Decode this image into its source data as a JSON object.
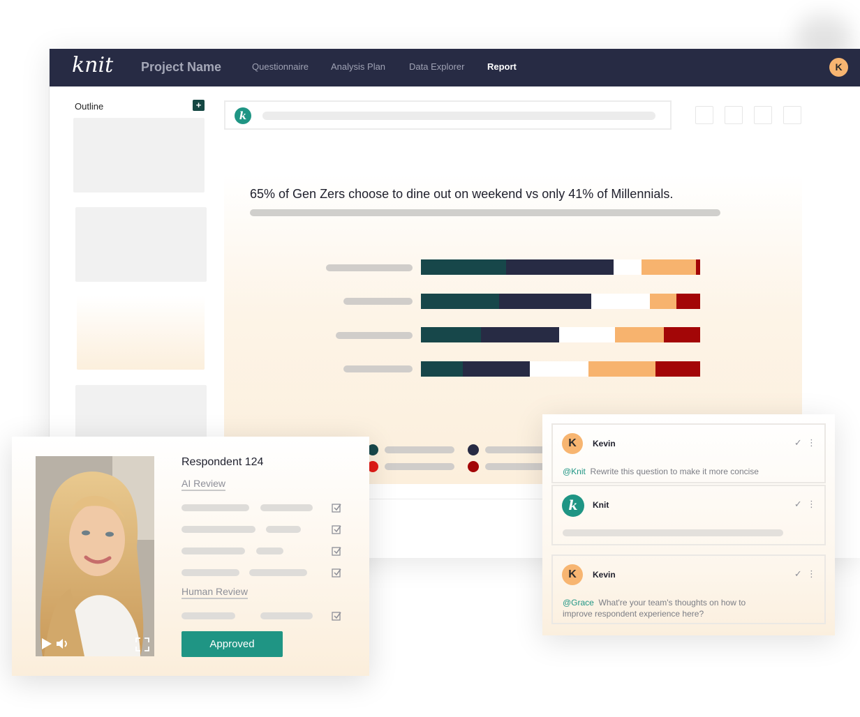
{
  "app": {
    "logo": "knit",
    "project_name": "Project Name",
    "nav": [
      "Questionnaire",
      "Analysis Plan",
      "Data Explorer",
      "Report"
    ],
    "active_nav": "Report",
    "user_initial": "K"
  },
  "sidebar": {
    "outline_label": "Outline",
    "add_icon": "plus-icon"
  },
  "search": {
    "assistant_initial": "k"
  },
  "chart": {
    "title": "65% of Gen Zers choose to dine out on weekend vs only 41% of Millennials.",
    "colors": [
      "#17474a",
      "#272b44",
      "#ffffff",
      "#f7b36e",
      "#a30607"
    ]
  },
  "chart_data": {
    "type": "bar",
    "stacked": true,
    "orientation": "horizontal",
    "title": "65% of Gen Zers choose to dine out on weekend vs only 41% of Millennials.",
    "categories": [
      "",
      "",
      "",
      ""
    ],
    "series": [
      {
        "values": [
          30.5,
          28,
          21.5,
          15
        ]
      },
      {
        "values": [
          38.5,
          33,
          28,
          24
        ]
      },
      {
        "values": [
          10,
          21,
          20,
          21
        ]
      },
      {
        "values": [
          19.5,
          9.5,
          17.5,
          24
        ]
      },
      {
        "values": [
          1.5,
          8.5,
          13,
          16
        ]
      }
    ],
    "xlim": [
      0,
      100
    ],
    "grid": false,
    "legend": "bottom"
  },
  "respondent": {
    "title": "Respondent 124",
    "ai_review": "AI Review",
    "human_review": "Human Review",
    "approved": "Approved",
    "video_controls": [
      "play-icon",
      "volume-icon",
      "expand-icon"
    ]
  },
  "comments": [
    {
      "initial": "K",
      "author": "Kevin",
      "mention": "@Knit",
      "text": "Rewrite this question to make it more concise"
    },
    {
      "initial": "k",
      "author": "Knit",
      "mention": "",
      "text": ""
    },
    {
      "initial": "K",
      "author": "Kevin",
      "mention": "@Grace",
      "text": "What're your team's thoughts on how to improve respondent experience here?"
    }
  ]
}
